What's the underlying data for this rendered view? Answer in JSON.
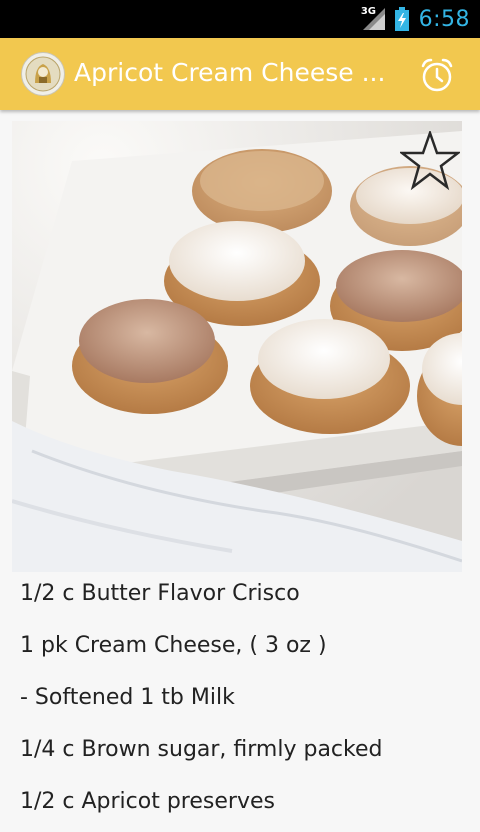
{
  "status_bar": {
    "network": "3G",
    "time": "6:58"
  },
  "action_bar": {
    "title": "Apricot Cream Cheese ..."
  },
  "icons": {
    "app": "app-logo-icon",
    "alarm": "alarm-clock-icon",
    "favorite": "star-outline-icon"
  },
  "colors": {
    "status_bar_bg": "#000000",
    "clock": "#33b5e5",
    "action_bar_bg": "#f2c84f",
    "page_bg": "#f7f7f7"
  },
  "ingredients": [
    "1/2 c Butter Flavor Crisco",
    "1 pk Cream Cheese, ( 3 oz )",
    "- Softened 1 tb Milk",
    "1/4 c Brown sugar, firmly packed",
    "1/2 c Apricot preserves"
  ]
}
